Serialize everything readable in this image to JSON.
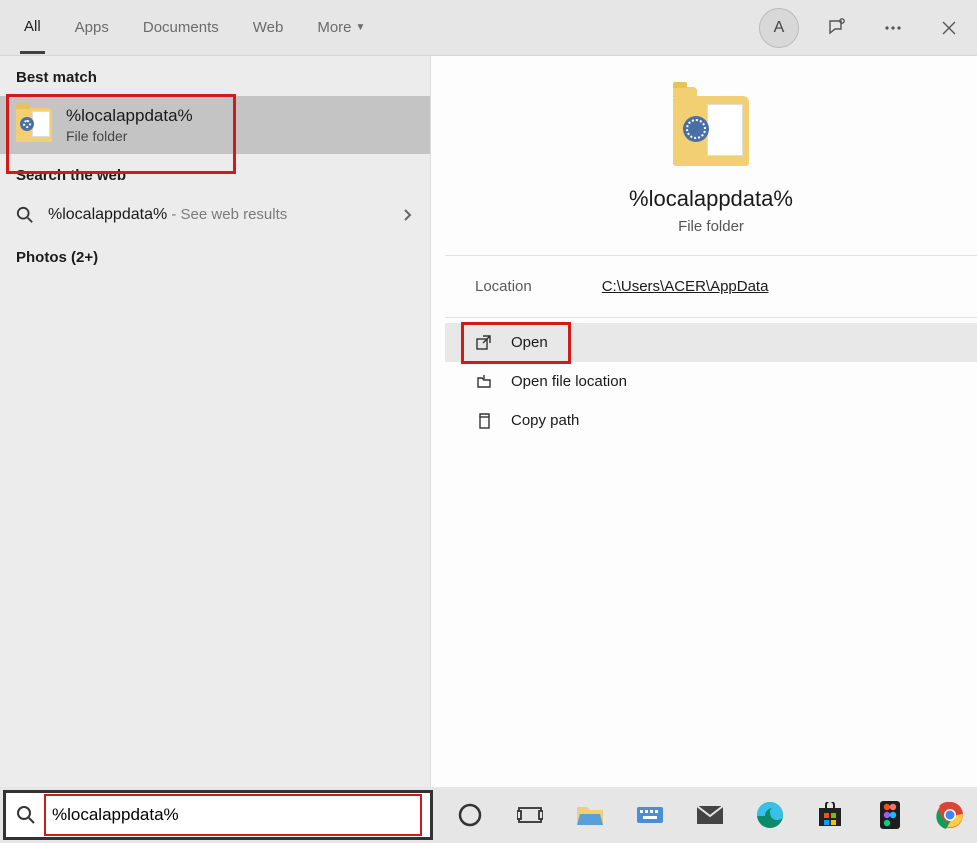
{
  "tabs": {
    "all": "All",
    "apps": "Apps",
    "documents": "Documents",
    "web": "Web",
    "more": "More"
  },
  "avatar_letter": "A",
  "left": {
    "best_match_hdr": "Best match",
    "result_title": "%localappdata%",
    "result_subtitle": "File folder",
    "web_hdr": "Search the web",
    "web_query": "%localappdata%",
    "web_suffix": " - See web results",
    "photos_hdr": "Photos (2+)"
  },
  "detail": {
    "title": "%localappdata%",
    "subtitle": "File folder",
    "location_label": "Location",
    "location_value": "C:\\Users\\ACER\\AppData",
    "actions": {
      "open": "Open",
      "open_loc": "Open file location",
      "copy_path": "Copy path"
    }
  },
  "search_value": "%localappdata%",
  "taskbar_icons": [
    "cortana",
    "task-view",
    "file-explorer",
    "keyboard",
    "mail",
    "edge",
    "store",
    "figma",
    "chrome"
  ]
}
